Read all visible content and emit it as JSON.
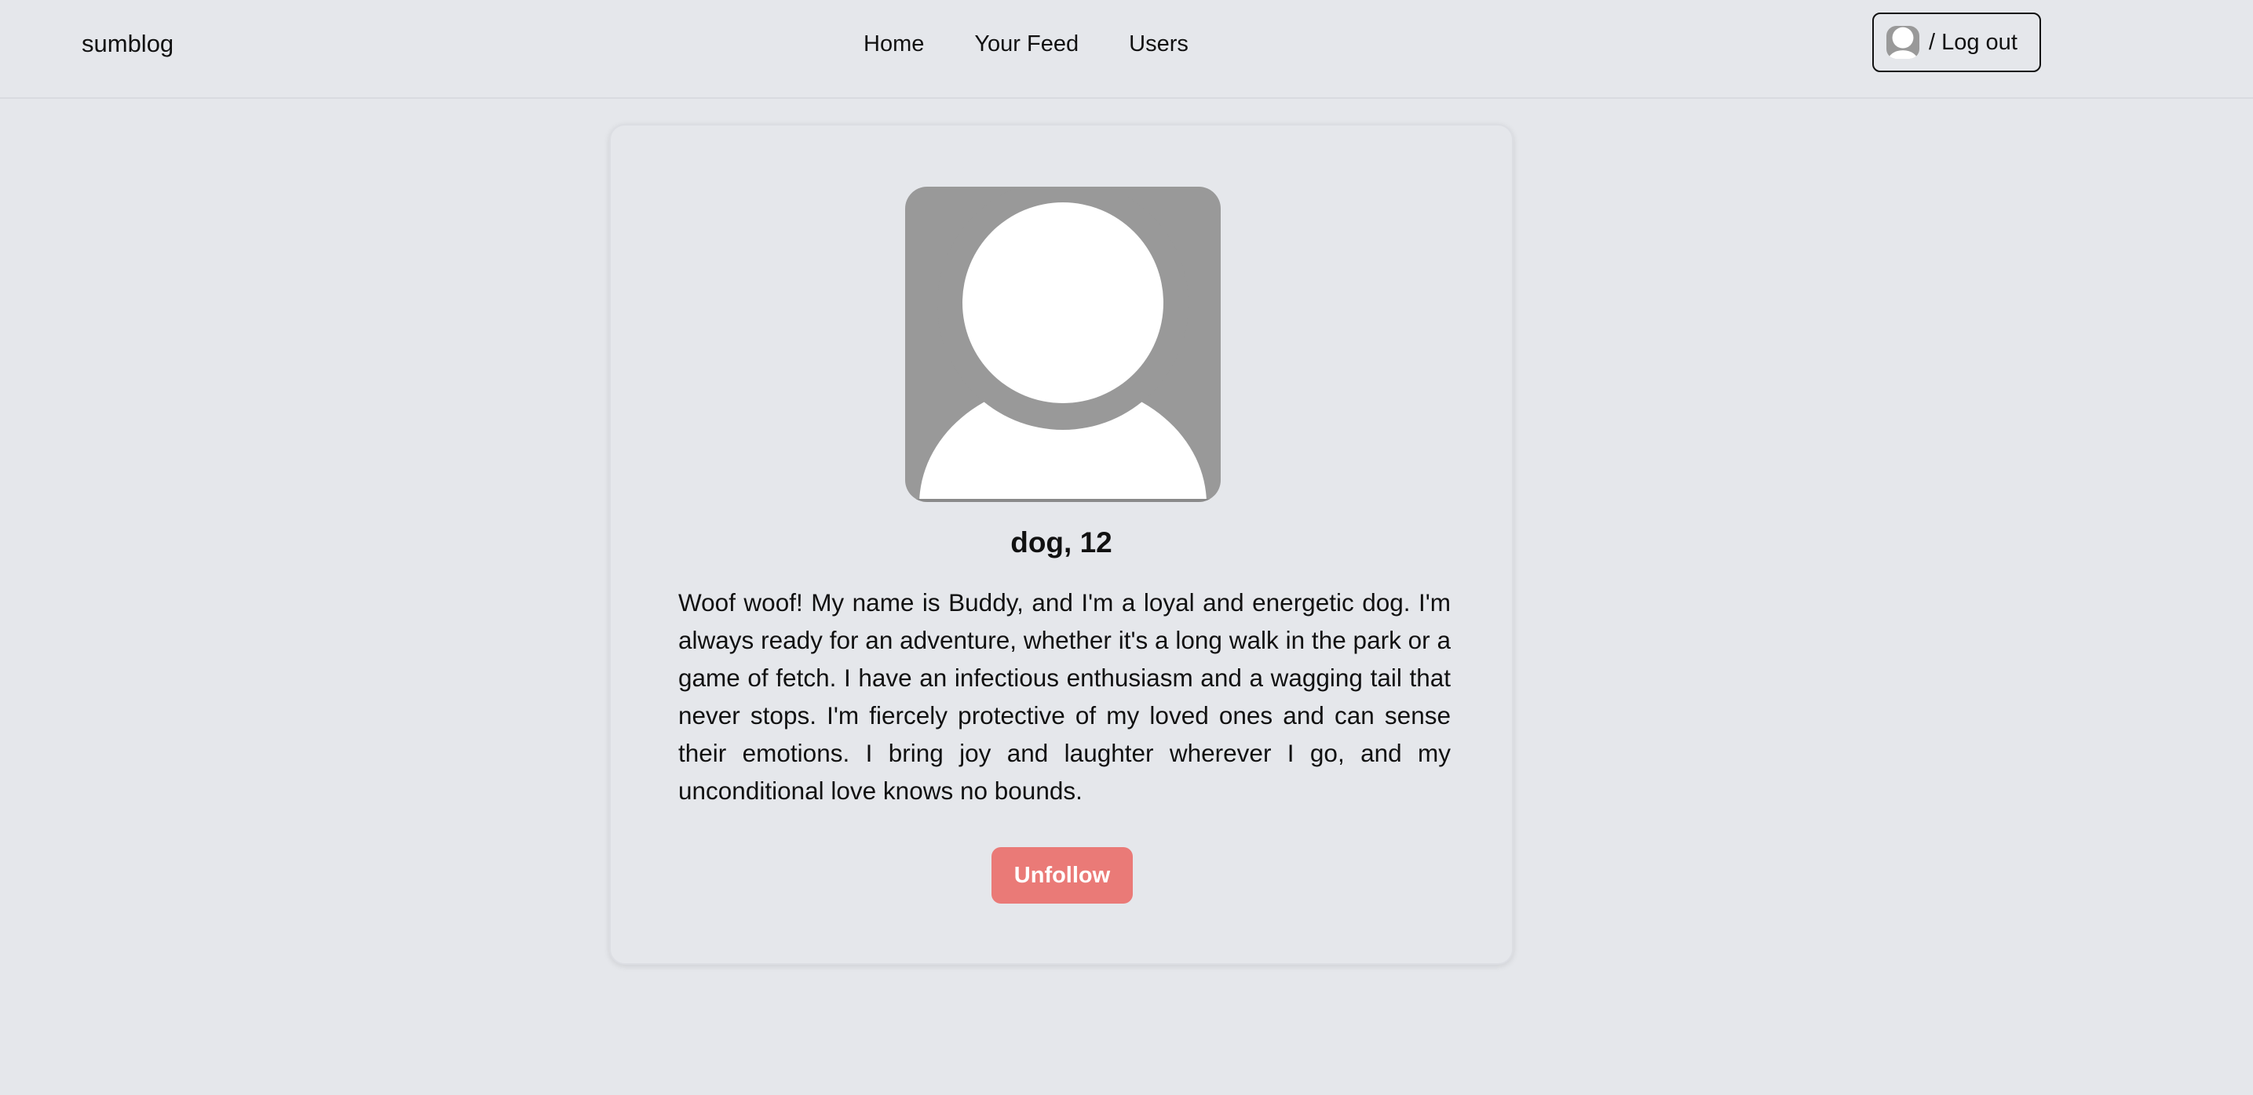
{
  "header": {
    "brand": "sumblog",
    "nav_items": [
      {
        "label": "Home"
      },
      {
        "label": "Your Feed"
      },
      {
        "label": "Users"
      }
    ],
    "logout_label": "/ Log out",
    "avatar_icon": "user-placeholder-icon"
  },
  "profile": {
    "avatar_icon": "user-placeholder-icon",
    "title": "dog, 12",
    "bio": "Woof woof! My name is Buddy, and I'm a loyal and energetic dog. I'm always ready for an adventure, whether it's a long walk in the park or a game of fetch. I have an infectious enthusiasm and a wagging tail that never stops. I'm fiercely protective of my loved ones and can sense their emotions. I bring joy and laughter wherever I go, and my unconditional love knows no bounds.",
    "unfollow_label": "Unfollow"
  },
  "colors": {
    "page_background": "#e5e7eb",
    "avatar_background": "#999999",
    "unfollow_button": "#ea7a77",
    "text": "#111111"
  }
}
